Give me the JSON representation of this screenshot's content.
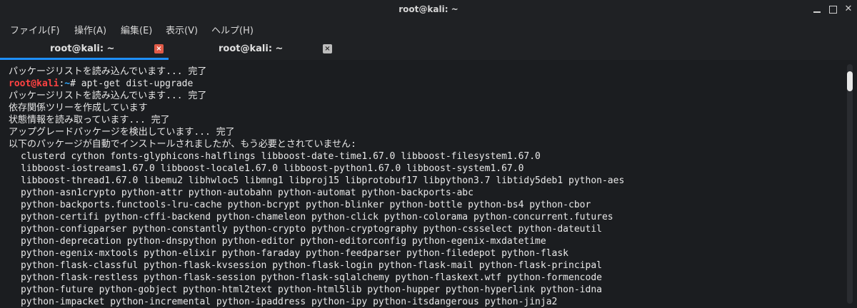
{
  "window": {
    "title": "root@kali: ~"
  },
  "menu": [
    {
      "label": "ファイル(F)"
    },
    {
      "label": "操作(A)"
    },
    {
      "label": "編集(E)"
    },
    {
      "label": "表示(V)"
    },
    {
      "label": "ヘルプ(H)"
    }
  ],
  "tabs": [
    {
      "label": "root@kali: ~",
      "active": true,
      "close": "×"
    },
    {
      "label": "root@kali: ~",
      "active": false,
      "close": "×"
    }
  ],
  "terminal": {
    "line0": "パッケージリストを読み込んでいます... 完了",
    "prompt": {
      "user": "root@kali",
      "sep": ":",
      "path": "~",
      "symbol": "# ",
      "command": "apt-get dist-upgrade"
    },
    "lines": [
      "パッケージリストを読み込んでいます... 完了",
      "依存関係ツリーを作成しています",
      "状態情報を読み取っています... 完了",
      "アップグレードパッケージを検出しています... 完了",
      "以下のパッケージが自動でインストールされましたが、もう必要とされていません:"
    ],
    "packages": [
      "clusterd cython fonts-glyphicons-halflings libboost-date-time1.67.0 libboost-filesystem1.67.0",
      "libboost-iostreams1.67.0 libboost-locale1.67.0 libboost-python1.67.0 libboost-system1.67.0",
      "libboost-thread1.67.0 libemu2 libhwloc5 libmng1 libproj15 libprotobuf17 libpython3.7 libtidy5deb1 python-aes",
      "python-asn1crypto python-attr python-autobahn python-automat python-backports-abc",
      "python-backports.functools-lru-cache python-bcrypt python-blinker python-bottle python-bs4 python-cbor",
      "python-certifi python-cffi-backend python-chameleon python-click python-colorama python-concurrent.futures",
      "python-configparser python-constantly python-crypto python-cryptography python-cssselect python-dateutil",
      "python-deprecation python-dnspython python-editor python-editorconfig python-egenix-mxdatetime",
      "python-egenix-mxtools python-elixir python-faraday python-feedparser python-filedepot python-flask",
      "python-flask-classful python-flask-kvsession python-flask-login python-flask-mail python-flask-principal",
      "python-flask-restless python-flask-session python-flask-sqlalchemy python-flaskext.wtf python-formencode",
      "python-future python-gobject python-html2text python-html5lib python-hupper python-hyperlink python-idna",
      "python-impacket python-incremental python-ipaddress python-ipy python-itsdangerous python-jinja2"
    ]
  },
  "colors": {
    "prompt_user": "#ff4242",
    "prompt_path": "#2ea8ff",
    "active_tab": "#1e90ff",
    "close_active": "#e05a47"
  }
}
